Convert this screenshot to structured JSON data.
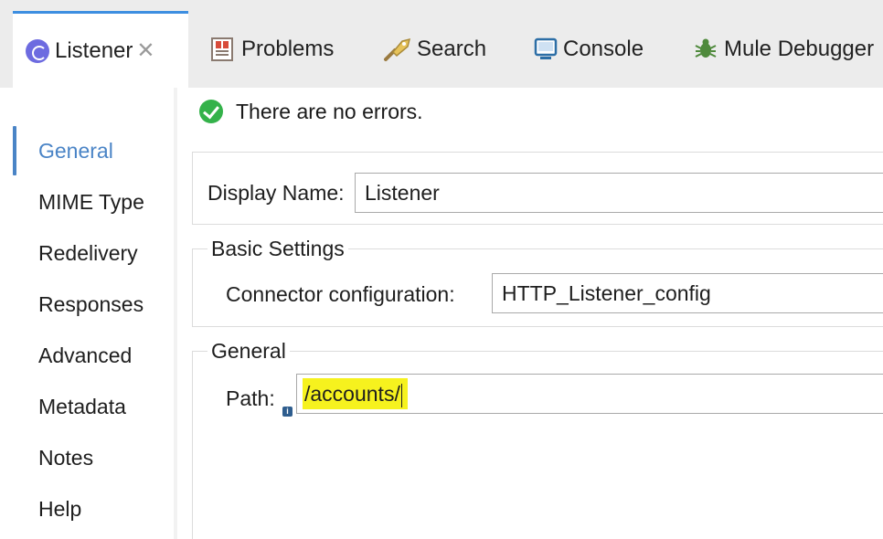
{
  "tabs": [
    {
      "label": "Listener",
      "icon": "listener-icon",
      "active": true
    },
    {
      "label": "Problems",
      "icon": "problems-icon"
    },
    {
      "label": "Search",
      "icon": "search-icon"
    },
    {
      "label": "Console",
      "icon": "console-icon"
    },
    {
      "label": "Mule Debugger",
      "icon": "debugger-icon"
    }
  ],
  "sidebar": {
    "items": [
      {
        "label": "General",
        "active": true
      },
      {
        "label": "MIME Type"
      },
      {
        "label": "Redelivery"
      },
      {
        "label": "Responses"
      },
      {
        "label": "Advanced"
      },
      {
        "label": "Metadata"
      },
      {
        "label": "Notes"
      },
      {
        "label": "Help"
      }
    ]
  },
  "status": {
    "text": "There are no errors."
  },
  "display": {
    "label": "Display Name:",
    "value": "Listener"
  },
  "basic": {
    "title": "Basic Settings",
    "connector_label": "Connector configuration:",
    "connector_value": "HTTP_Listener_config"
  },
  "general": {
    "title": "General",
    "path_label": "Path:",
    "path_value": "/accounts/"
  },
  "colors": {
    "accent": "#4a84c6",
    "highlight": "#f6f21e",
    "ok": "#34b24a"
  }
}
